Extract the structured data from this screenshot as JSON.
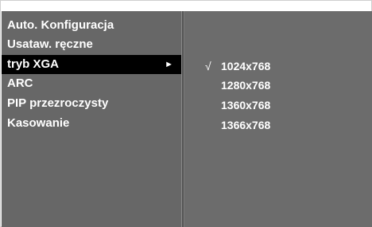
{
  "menu": {
    "items": [
      {
        "label": "Auto. Konfiguracja"
      },
      {
        "label": "Usataw. ręczne"
      },
      {
        "label": "tryb XGA",
        "selected": true,
        "submenu_icon": "play-arrow-icon",
        "arrow_glyph": "►"
      },
      {
        "label": "ARC"
      },
      {
        "label": "PIP przezroczysty"
      },
      {
        "label": "Kasowanie"
      }
    ]
  },
  "submenu": {
    "check_glyph": "√",
    "options": [
      {
        "label": "1024x768",
        "checked": true
      },
      {
        "label": "1280x768",
        "checked": false
      },
      {
        "label": "1360x768",
        "checked": false
      },
      {
        "label": "1366x768",
        "checked": false
      }
    ]
  },
  "colors": {
    "panel_background": "#6c6c6c",
    "selected_background": "#000000",
    "text": "#ffffff"
  }
}
